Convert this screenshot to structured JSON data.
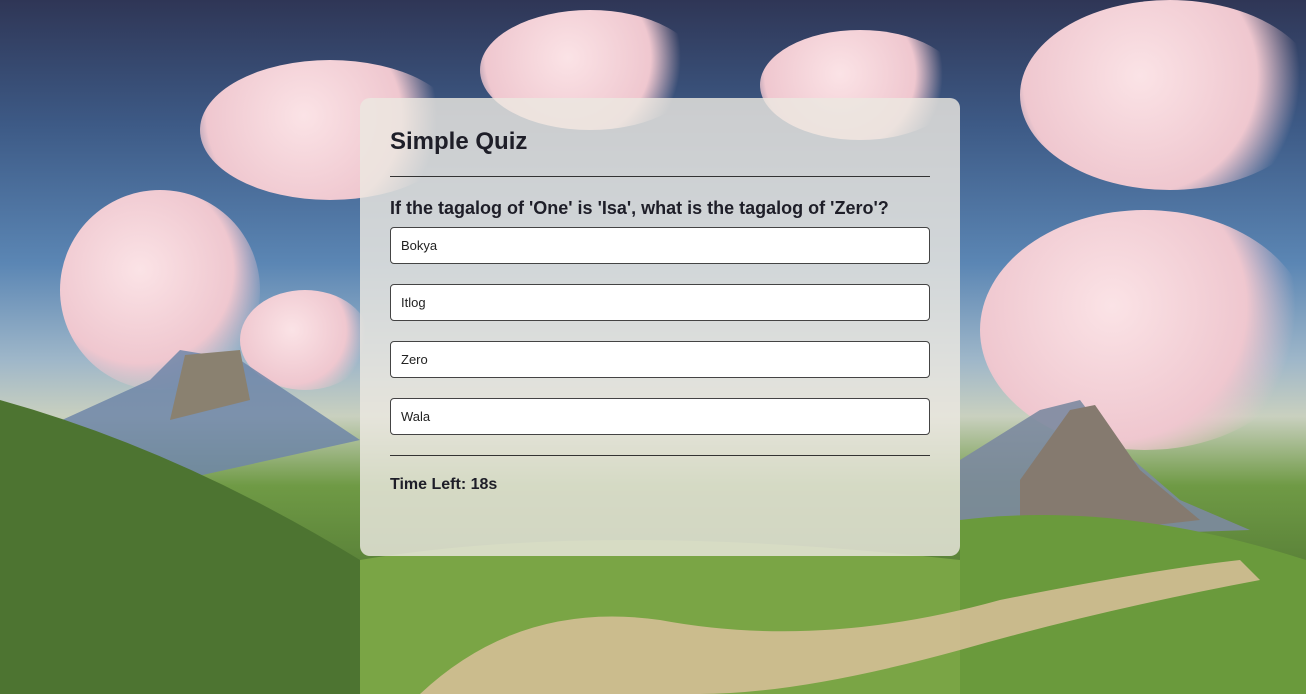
{
  "quiz": {
    "title": "Simple Quiz",
    "question": "If the tagalog of 'One' is 'Isa', what is the tagalog of 'Zero'?",
    "answers": [
      "Bokya",
      "Itlog",
      "Zero",
      "Wala"
    ],
    "timer_label": "Time Left:",
    "timer_value": "18s"
  },
  "colors": {
    "card_background": "#ebe8e0",
    "text": "#1e1e28",
    "answer_background": "#ffffff",
    "answer_border": "#444444"
  }
}
